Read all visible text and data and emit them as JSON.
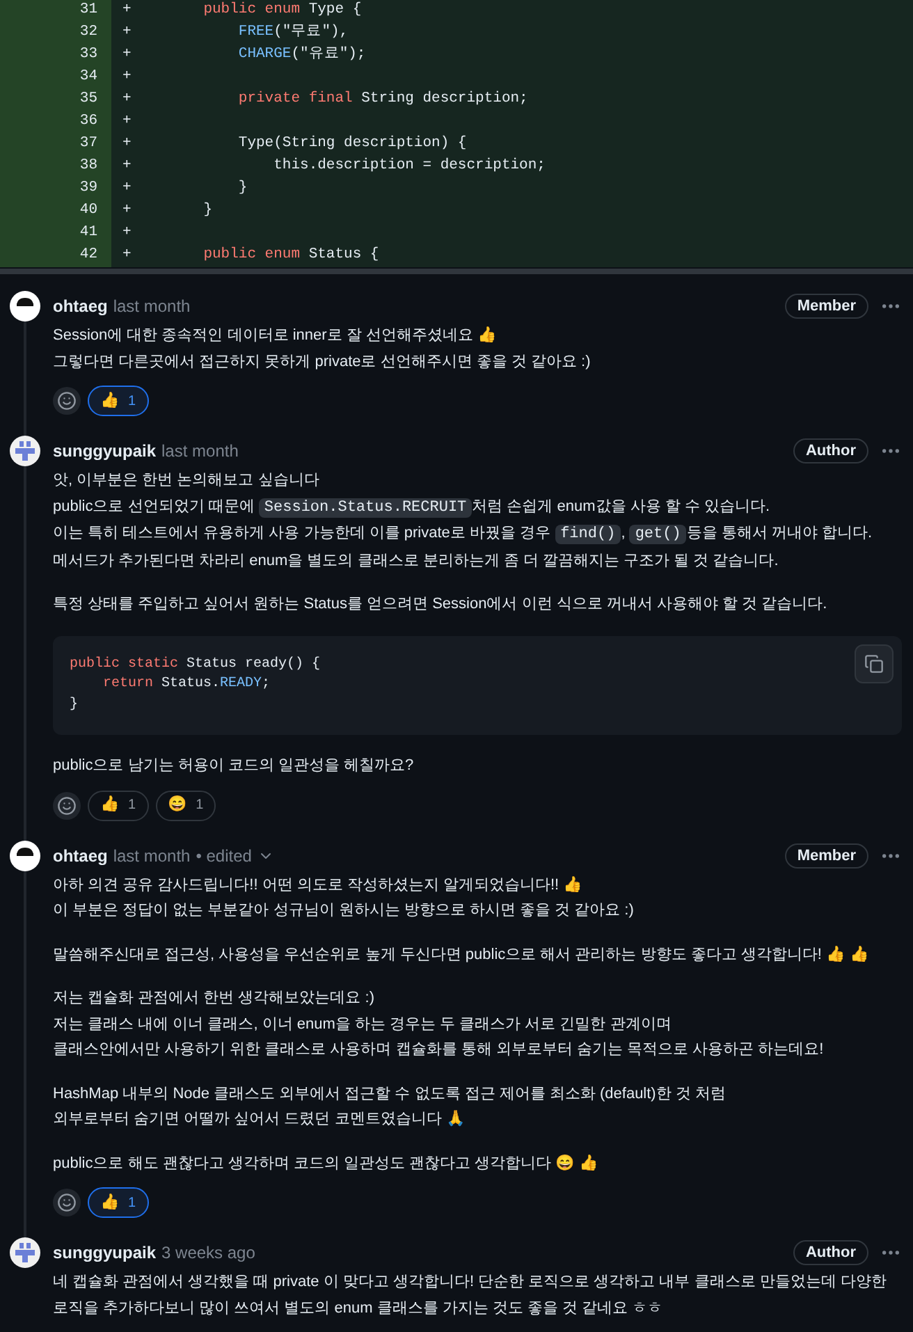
{
  "diff": {
    "lines": [
      {
        "number": "31",
        "sign": "+",
        "tokens": [
          {
            "text": "    public enum ",
            "kind": "kw"
          },
          {
            "text": "Type {",
            "kind": "plain"
          }
        ]
      },
      {
        "number": "32",
        "sign": "+",
        "tokens": [
          {
            "text": "        FREE",
            "kind": "const"
          },
          {
            "text": "(\"무료\"),",
            "kind": "plain"
          }
        ]
      },
      {
        "number": "33",
        "sign": "+",
        "tokens": [
          {
            "text": "        CHARGE",
            "kind": "const"
          },
          {
            "text": "(\"유료\");",
            "kind": "plain"
          }
        ]
      },
      {
        "number": "34",
        "sign": "+"
      },
      {
        "number": "35",
        "sign": "+",
        "tokens": [
          {
            "text": "        private final ",
            "kind": "kw"
          },
          {
            "text": "String description;",
            "kind": "plain"
          }
        ]
      },
      {
        "number": "36",
        "sign": "+"
      },
      {
        "number": "37",
        "sign": "+",
        "tokens": [
          {
            "text": "        Type(String description) {",
            "kind": "plain"
          }
        ]
      },
      {
        "number": "38",
        "sign": "+",
        "tokens": [
          {
            "text": "            this.description = description;",
            "kind": "plain"
          }
        ]
      },
      {
        "number": "39",
        "sign": "+",
        "tokens": [
          {
            "text": "        }",
            "kind": "plain"
          }
        ]
      },
      {
        "number": "40",
        "sign": "+",
        "tokens": [
          {
            "text": "    }",
            "kind": "plain"
          }
        ]
      },
      {
        "number": "41",
        "sign": "+"
      },
      {
        "number": "42",
        "sign": "+",
        "tokens": [
          {
            "text": "    public enum ",
            "kind": "kw"
          },
          {
            "text": "Status {",
            "kind": "plain"
          }
        ]
      }
    ]
  },
  "comments": [
    {
      "kind": "face",
      "author": "ohtaeg",
      "time": "last month",
      "role": "Member",
      "blocks": [
        {
          "kind": "p",
          "lines": [
            [
              {
                "text": "Session에 대한 종속적인 데이터로 inner로 잘 선언해주셨네요 👍",
                "kind": "text"
              }
            ],
            [
              {
                "text": "그렇다면 다른곳에서 접근하지 못하게 private로 선언해주시면 좋을 것 같아요 :)",
                "kind": "text"
              }
            ]
          ]
        }
      ],
      "reactions": [
        {
          "emoji": "👍",
          "count": "1",
          "selected": true
        }
      ]
    },
    {
      "kind": "identicon",
      "author": "sunggyupaik",
      "time": "last month",
      "role": "Author",
      "blocks": [
        {
          "kind": "p",
          "lines": [
            [
              {
                "text": "앗, 이부분은 한번 논의해보고 싶습니다",
                "kind": "text"
              }
            ],
            [
              {
                "text": "public으로 선언되었기 때문에 ",
                "kind": "text"
              },
              {
                "text": "Session.Status.RECRUIT",
                "kind": "code"
              },
              {
                "text": "처럼 손쉽게 enum값을 사용 할 수 있습니다.",
                "kind": "text"
              }
            ],
            [
              {
                "text": "이는 특히 테스트에서 유용하게 사용 가능한데 이를 private로 바꿨을 경우 ",
                "kind": "text"
              },
              {
                "text": "find()",
                "kind": "code"
              },
              {
                "text": ", ",
                "kind": "text"
              },
              {
                "text": "get()",
                "kind": "code"
              },
              {
                "text": "등을 통해서 꺼내야 합니다.",
                "kind": "text"
              }
            ],
            [
              {
                "text": "메서드가 추가된다면 차라리 enum을 별도의 클래스로 분리하는게 좀 더 깔끔해지는 구조가 될 것 같습니다.",
                "kind": "text"
              }
            ]
          ]
        },
        {
          "kind": "p",
          "lines": [
            [
              {
                "text": "특정 상태를 주입하고 싶어서 원하는 Status를 얻으려면 Session에서 이런 식으로 꺼내서 사용해야 할 것 같습니다.",
                "kind": "text"
              }
            ]
          ]
        },
        {
          "kind": "code",
          "lines": [
            [
              {
                "text": "public static ",
                "kind": "kw"
              },
              {
                "text": "Status ready() {",
                "kind": "plain"
              }
            ],
            [
              {
                "text": "    return ",
                "kind": "kw"
              },
              {
                "text": "Status.",
                "kind": "plain"
              },
              {
                "text": "READY",
                "kind": "const"
              },
              {
                "text": ";",
                "kind": "plain"
              }
            ],
            [
              {
                "text": "}",
                "kind": "plain"
              }
            ]
          ]
        },
        {
          "kind": "p",
          "lines": [
            [
              {
                "text": "public으로 남기는 허용이 코드의 일관성을 헤칠까요?",
                "kind": "text"
              }
            ]
          ]
        }
      ],
      "reactions": [
        {
          "emoji": "👍",
          "count": "1",
          "selected": false
        },
        {
          "emoji": "😄",
          "count": "1",
          "selected": false
        }
      ]
    },
    {
      "kind": "face",
      "author": "ohtaeg",
      "time": "last month",
      "edited_label": "• edited",
      "role": "Member",
      "blocks": [
        {
          "kind": "p",
          "lines": [
            [
              {
                "text": "아하 의견 공유 감사드립니다!! 어떤 의도로 작성하셨는지 알게되었습니다!! 👍",
                "kind": "text"
              }
            ],
            [
              {
                "text": "이 부분은 정답이 없는 부분같아 성규님이 원하시는 방향으로 하시면 좋을 것 같아요 :)",
                "kind": "text"
              }
            ]
          ]
        },
        {
          "kind": "p",
          "lines": [
            [
              {
                "text": "말씀해주신대로 접근성, 사용성을 우선순위로 높게 두신다면 public으로 해서 관리하는 방향도 좋다고 생각합니다! 👍 👍",
                "kind": "text"
              }
            ]
          ]
        },
        {
          "kind": "p",
          "lines": [
            [
              {
                "text": "저는 캡슐화 관점에서 한번 생각해보았는데요 :)",
                "kind": "text"
              }
            ],
            [
              {
                "text": "저는 클래스 내에 이너 클래스, 이너 enum을 하는 경우는 두 클래스가 서로 긴밀한 관계이며",
                "kind": "text"
              }
            ],
            [
              {
                "text": "클래스안에서만 사용하기 위한 클래스로 사용하며 캡슐화를 통해 외부로부터 숨기는 목적으로 사용하곤 하는데요!",
                "kind": "text"
              }
            ]
          ]
        },
        {
          "kind": "p",
          "lines": [
            [
              {
                "text": "HashMap 내부의 Node 클래스도 외부에서 접근할 수 없도록 접근 제어를 최소화 (default)한 것 처럼",
                "kind": "text"
              }
            ],
            [
              {
                "text": "외부로부터 숨기면 어떨까 싶어서 드렸던 코멘트였습니다 🙏",
                "kind": "text"
              }
            ]
          ]
        },
        {
          "kind": "p",
          "lines": [
            [
              {
                "text": "public으로 해도 괜찮다고 생각하며 코드의 일관성도 괜찮다고 생각합니다 😄  👍",
                "kind": "text"
              }
            ]
          ]
        }
      ],
      "reactions": [
        {
          "emoji": "👍",
          "count": "1",
          "selected": true
        }
      ]
    },
    {
      "kind": "identicon",
      "author": "sunggyupaik",
      "time": "3 weeks ago",
      "role": "Author",
      "blocks": [
        {
          "kind": "p",
          "lines": [
            [
              {
                "text": "네 캡슐화 관점에서 생각했을 때 private 이 맞다고 생각합니다! 단순한 로직으로 생각하고 내부 클래스로 만들었는데 다양한 로직을 추가하다보니 많이 쓰여서 별도의 enum 클래스를 가지는 것도 좋을 것 같네요 ㅎㅎ",
                "kind": "text"
              }
            ]
          ]
        }
      ]
    }
  ]
}
